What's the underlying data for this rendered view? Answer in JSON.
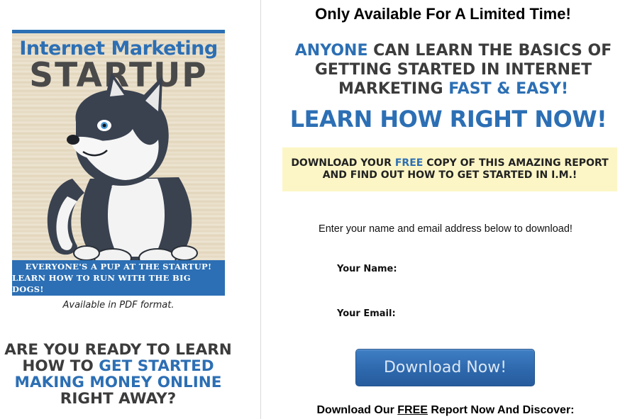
{
  "cover": {
    "title_line1": "Internet Marketing",
    "title_line2": "STARTUP",
    "banner_line1": "EVERYONE'S A PUP AT THE STARTUP!",
    "banner_line2": "LEARN HOW TO RUN WITH THE BIG DOGS!",
    "illustration": "husky-puppy-icon"
  },
  "caption": "Available in PDF format.",
  "ready": {
    "part1": "ARE YOU READY TO LEARN HOW TO",
    "highlight": "GET STARTED MAKING MONEY ONLINE",
    "part2": "RIGHT AWAY?"
  },
  "headline": "Only Available For A Limited Time!",
  "subheadline": {
    "w1": "ANYONE",
    "w2": "CAN LEARN THE BASICS OF GETTING STARTED IN INTERNET MARKETING",
    "w3": "FAST & EASY!"
  },
  "learn_now": "LEARN HOW RIGHT NOW!",
  "yellow_box": {
    "line1_a": "DOWNLOAD YOUR ",
    "line1_free": "FREE",
    "line1_b": " COPY OF THIS AMAZING REPORT",
    "line2": "AND FIND OUT HOW TO GET STARTED IN I.M.!"
  },
  "instructions": "Enter your name and email address below to download!",
  "form": {
    "name_label": "Your Name:",
    "name_value": "",
    "email_label": "Your Email:",
    "email_value": "",
    "button_label": "Download Now!"
  },
  "discover": {
    "before": "Download Our ",
    "free": "FREE",
    "after": " Report Now And Discover:"
  },
  "colors": {
    "accent_blue": "#2c6fb4",
    "heading_gray": "#3c3c3c",
    "highlight_yellow": "#fcf6c6"
  }
}
